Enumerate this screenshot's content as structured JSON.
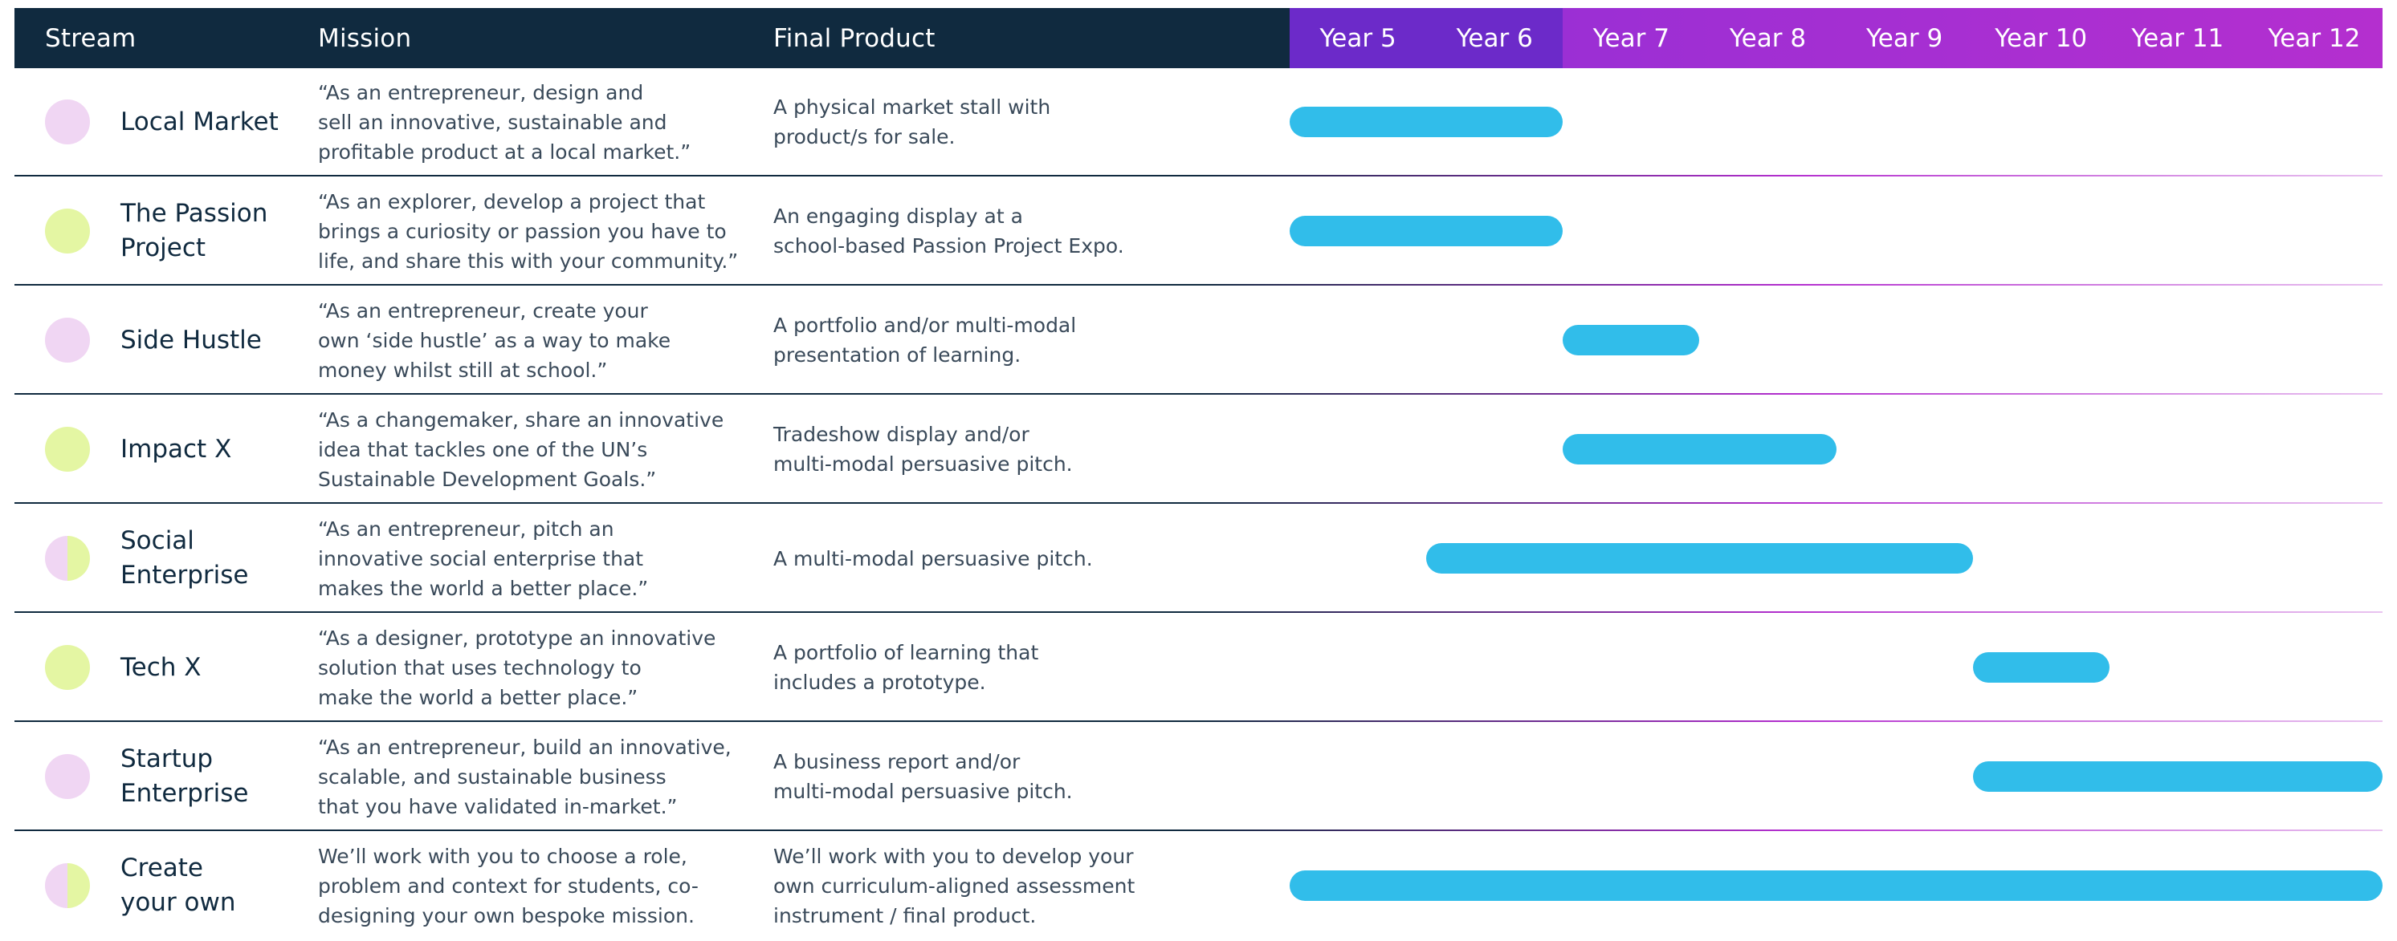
{
  "header": {
    "stream": "Stream",
    "mission": "Mission",
    "product": "Final Product",
    "years": [
      "Year 5",
      "Year 6",
      "Year 7",
      "Year 8",
      "Year 9",
      "Year 10",
      "Year 11",
      "Year 12"
    ],
    "highlighted_years": [
      "Year 5",
      "Year 6"
    ]
  },
  "colors": {
    "header_bg": "#102a3f",
    "year_gradient_start": "#7a2fd6",
    "year_gradient_end": "#b42fcf",
    "bar": "#31bdea",
    "dot_pink": "#f0d6f3",
    "dot_lime": "#e4f6a3"
  },
  "rows": [
    {
      "dot": "pink",
      "stream": "Local Market",
      "mission": "“As an entrepreneur, design and\nsell an innovative, sustainable and\nprofitable product at a local market.”",
      "product": "A physical market stall with\nproduct/s for sale.",
      "span": {
        "start_year": 5,
        "end_year": 7
      }
    },
    {
      "dot": "lime",
      "stream": "The Passion\nProject",
      "mission": "“As an explorer, develop a project that\nbrings a curiosity or passion you have to\nlife, and share this with your community.”",
      "product": "An engaging display at a\nschool-based Passion Project Expo.",
      "span": {
        "start_year": 5,
        "end_year": 7
      }
    },
    {
      "dot": "pink",
      "stream": "Side Hustle",
      "mission": "“As an entrepreneur, create your\nown ‘side hustle’ as a way to make\nmoney whilst still at school.”",
      "product": "A portfolio and/or multi-modal\npresentation of learning.",
      "span": {
        "start_year": 7,
        "end_year": 8
      }
    },
    {
      "dot": "lime",
      "stream": "Impact X",
      "mission": "“As a changemaker, share an innovative\nidea that tackles one of the UN’s\nSustainable Development Goals.”",
      "product": "Tradeshow display and/or\nmulti-modal persuasive pitch.",
      "span": {
        "start_year": 7,
        "end_year": 9
      }
    },
    {
      "dot": "split",
      "stream": "Social\nEnterprise",
      "mission": "“As an entrepreneur, pitch an\ninnovative social enterprise that\nmakes the world a better place.”",
      "product": "A multi-modal persuasive pitch.",
      "span": {
        "start_year": 6,
        "end_year": 10
      }
    },
    {
      "dot": "lime",
      "stream": "Tech X",
      "mission": "“As a designer, prototype an innovative\nsolution that uses technology to\nmake the world a better place.”",
      "product": "A portfolio of learning that\nincludes a prototype.",
      "span": {
        "start_year": 10,
        "end_year": 11
      }
    },
    {
      "dot": "pink",
      "stream": "Startup\nEnterprise",
      "mission": "“As an entrepreneur, build an innovative,\nscalable, and sustainable business\nthat you have validated in-market.”",
      "product": "A business report and/or\nmulti-modal persuasive pitch.",
      "span": {
        "start_year": 10,
        "end_year": 12
      }
    },
    {
      "dot": "split",
      "stream": "Create\nyour own",
      "mission": "We’ll work with you to choose a role,\nproblem and context for students, co-\ndesigning your own bespoke mission.",
      "product": "We’ll work with you to develop your\nown curriculum-aligned assessment\ninstrument / final product.",
      "span": {
        "start_year": 5,
        "end_year": 12
      }
    }
  ]
}
